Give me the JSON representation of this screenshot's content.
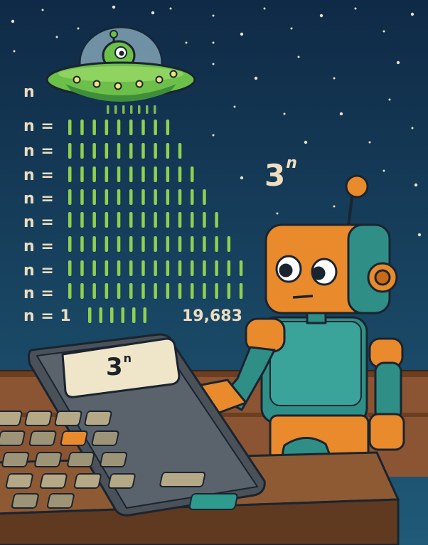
{
  "labels": {
    "top_label": "n",
    "row_prefix": "n =",
    "last_row_prefix": "n = 1",
    "result_value": "19,683",
    "power_base": "3",
    "power_exponent": "n",
    "calculator_base": "3",
    "calculator_exponent": "n"
  },
  "tally": {
    "row_tick_counts": [
      9,
      10,
      11,
      12,
      13,
      14,
      15,
      15
    ],
    "last_row_tick_count": 6,
    "beam_tick_count": 7
  },
  "colors": {
    "sky_top": "#0f2a46",
    "sky_bottom": "#1f5a78",
    "tally_green": "#8fd14f",
    "ufo_green": "#6cc04a",
    "robot_orange": "#e98a2c",
    "robot_teal": "#2f8f86",
    "desk_brown": "#7a4a2c",
    "calculator_body": "#4a5158",
    "text_cream": "#ecdcc0"
  },
  "icons": [
    "ufo-icon",
    "alien-icon",
    "robot-icon",
    "calculator-icon"
  ]
}
